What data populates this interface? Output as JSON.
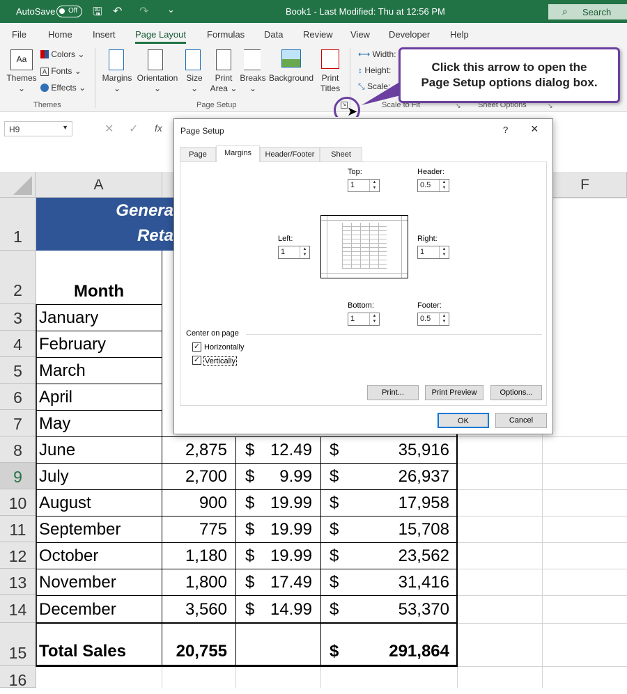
{
  "titlebar": {
    "autosave": "AutoSave",
    "toggle": "Off",
    "doc_title": "Book1  -  Last Modified: Thu at 12:56 PM",
    "search": "Search"
  },
  "tabs": [
    "File",
    "Home",
    "Insert",
    "Page Layout",
    "Formulas",
    "Data",
    "Review",
    "View",
    "Developer",
    "Help"
  ],
  "ribbon": {
    "themes": {
      "themes": "Themes",
      "colors": "Colors",
      "fonts": "Fonts",
      "effects": "Effects",
      "group": "Themes"
    },
    "page_setup": {
      "margins": "Margins",
      "orientation": "Orientation",
      "size": "Size",
      "print_area_1": "Print",
      "print_area_2": "Area",
      "breaks": "Breaks",
      "background": "Background",
      "print_titles_1": "Print",
      "print_titles_2": "Titles",
      "group": "Page Setup"
    },
    "scale": {
      "width": "Width:",
      "height": "Height:",
      "scale": "Scale:",
      "group": "Scale to Fit"
    },
    "sheet_options": {
      "group": "Sheet Options"
    }
  },
  "formula_bar": {
    "namebox": "H9",
    "fx": "fx"
  },
  "sheet": {
    "columns": [
      "A",
      "F"
    ],
    "title_line1": "Genera",
    "title_line2": "Reta",
    "month_header": "Month",
    "row_numbers": [
      "1",
      "2",
      "3",
      "4",
      "5",
      "6",
      "7",
      "8",
      "9",
      "10",
      "11",
      "12",
      "13",
      "14",
      "15",
      "16"
    ],
    "months": [
      "January",
      "February",
      "March",
      "April",
      "May",
      "June",
      "July",
      "August",
      "September",
      "October",
      "November",
      "December"
    ],
    "rows": [
      {
        "units": "2,875",
        "price": "12.49",
        "total": "35,916"
      },
      {
        "units": "2,700",
        "price": "9.99",
        "total": "26,937"
      },
      {
        "units": "900",
        "price": "19.99",
        "total": "17,958"
      },
      {
        "units": "775",
        "price": "19.99",
        "total": "15,708"
      },
      {
        "units": "1,180",
        "price": "19.99",
        "total": "23,562"
      },
      {
        "units": "1,800",
        "price": "17.49",
        "total": "31,416"
      },
      {
        "units": "3,560",
        "price": "14.99",
        "total": "53,370"
      }
    ],
    "currency": "$",
    "total_label": "Total Sales",
    "total_units": "20,755",
    "total_sales": "291,864"
  },
  "dialog": {
    "title": "Page Setup",
    "help": "?",
    "close": "×",
    "tabs": [
      "Page",
      "Margins",
      "Header/Footer",
      "Sheet"
    ],
    "top_label": "Top:",
    "top": "1",
    "header_label": "Header:",
    "header": "0.5",
    "left_label": "Left:",
    "left": "1",
    "right_label": "Right:",
    "right": "1",
    "bottom_label": "Bottom:",
    "bottom": "1",
    "footer_label": "Footer:",
    "footer": "0.5",
    "center_label": "Center on page",
    "horizontally": "Horizontally",
    "vertically": "Vertically",
    "print_btn": "Print...",
    "preview_btn": "Print Preview",
    "options_btn": "Options...",
    "ok": "OK",
    "cancel": "Cancel"
  },
  "callout": {
    "line1": "Click this arrow to open the",
    "line2": "Page Setup options dialog box."
  },
  "colors": {
    "excel_green": "#217346",
    "title_fill": "#2f5597",
    "callout_border": "#6b3fa0"
  }
}
